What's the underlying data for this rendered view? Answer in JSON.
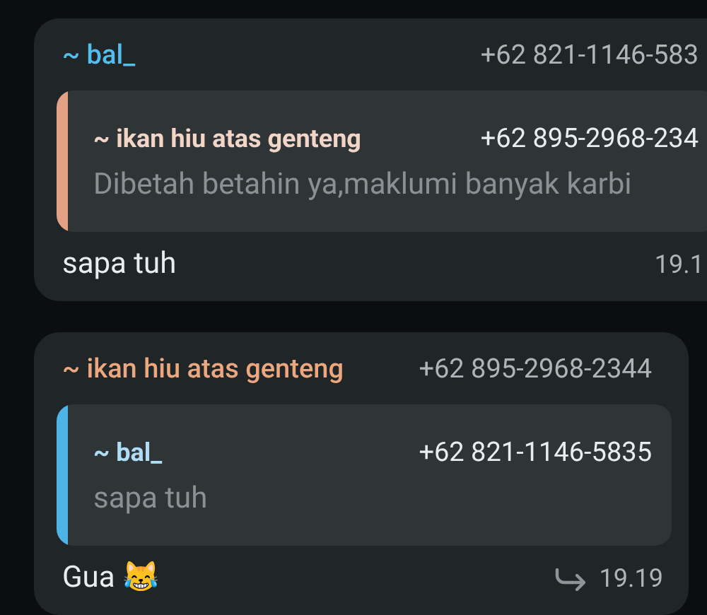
{
  "messages": [
    {
      "sender": "~ bal_",
      "color": "#53bdeb",
      "phone": "+62 821-1146-583",
      "quote": {
        "sender": "~ ikan hiu atas genteng",
        "color": "#e2a283",
        "phone": "+62 895-2968-234",
        "text": "Dibetah betahin ya,maklumi banyak karbi"
      },
      "text": "sapa tuh",
      "time": "19.1",
      "forwarded": false,
      "cut_right": true
    },
    {
      "sender": "~ ikan hiu atas genteng",
      "color": "#eda77f",
      "phone": "+62 895-2968-2344",
      "quote": {
        "sender": "~ bal_",
        "color": "#4db4e8",
        "phone": "+62 821-1146-5835",
        "text": "sapa tuh"
      },
      "text": "Gua 😹",
      "time": "19.19",
      "forwarded": true,
      "cut_right": false
    }
  ]
}
